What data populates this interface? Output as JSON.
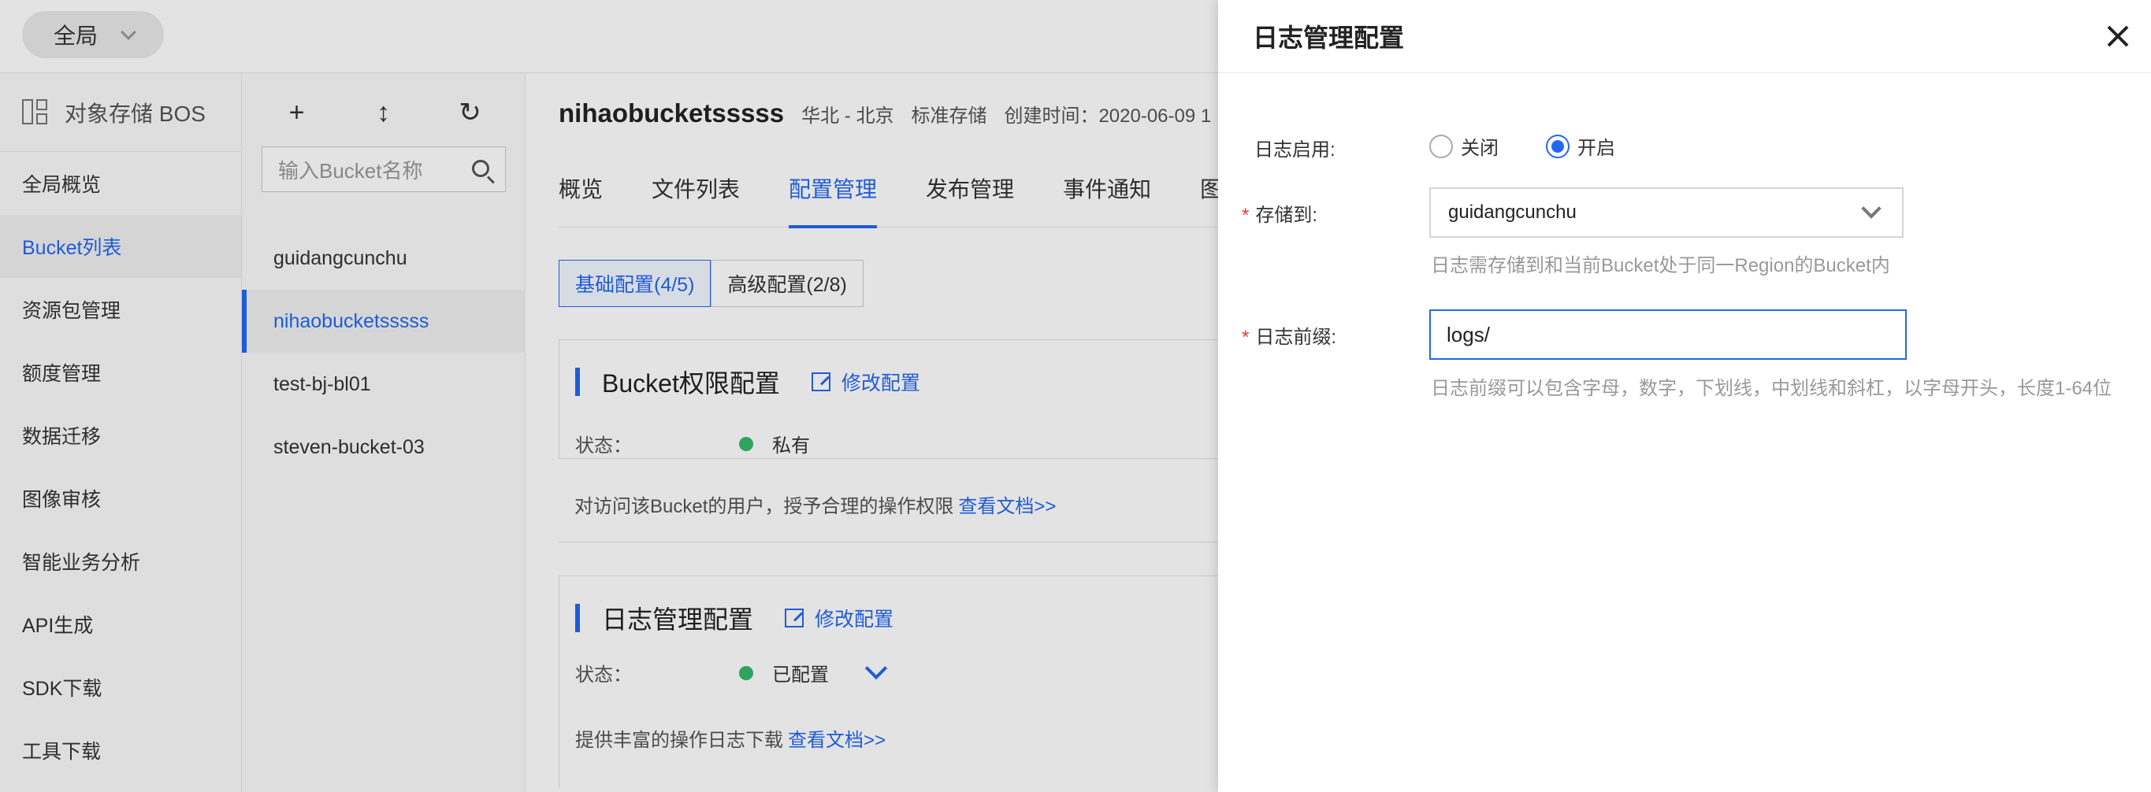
{
  "topbar": {
    "region": "全局"
  },
  "sidebar": {
    "title": "对象存储 BOS",
    "items": [
      {
        "label": "全局概览"
      },
      {
        "label": "Bucket列表"
      },
      {
        "label": "资源包管理"
      },
      {
        "label": "额度管理"
      },
      {
        "label": "数据迁移"
      },
      {
        "label": "图像审核"
      },
      {
        "label": "智能业务分析"
      },
      {
        "label": "API生成"
      },
      {
        "label": "SDK下载"
      },
      {
        "label": "工具下载"
      }
    ]
  },
  "bucket_panel": {
    "tool_add": "+",
    "tool_sort": "↕",
    "tool_refresh": "↻",
    "search_placeholder": "输入Bucket名称",
    "buckets": [
      {
        "name": "guidangcunchu"
      },
      {
        "name": "nihaobucketsssss"
      },
      {
        "name": "test-bj-bl01"
      },
      {
        "name": "steven-bucket-03"
      }
    ]
  },
  "main": {
    "bucket_name": "nihaobucketsssss",
    "region": "华北 - 北京",
    "storage_class": "标准存储",
    "created": "创建时间：2020-06-09 1",
    "tabs": [
      {
        "label": "概览"
      },
      {
        "label": "文件列表"
      },
      {
        "label": "配置管理"
      },
      {
        "label": "发布管理"
      },
      {
        "label": "事件通知"
      },
      {
        "label": "图片"
      }
    ],
    "subtabs": [
      {
        "label": "基础配置(4/5)"
      },
      {
        "label": "高级配置(2/8)"
      }
    ],
    "cards": [
      {
        "title": "Bucket权限配置",
        "edit": "修改配置",
        "status_label": "状态：",
        "status_value": "私有",
        "desc": "对访问该Bucket的用户，授予合理的操作权限",
        "doc_link": "查看文档>>"
      },
      {
        "title": "日志管理配置",
        "edit": "修改配置",
        "status_label": "状态：",
        "status_value": "已配置",
        "desc": "提供丰富的操作日志下载",
        "doc_link": "查看文档>>"
      }
    ]
  },
  "drawer": {
    "title": "日志管理配置",
    "enable_label": "日志启用:",
    "radio_off": "关闭",
    "radio_on": "开启",
    "required_mark": "*",
    "store_label": "存储到:",
    "store_value": "guidangcunchu",
    "store_hint": "日志需存储到和当前Bucket处于同一Region的Bucket内",
    "prefix_label": "日志前缀:",
    "prefix_value": "logs/",
    "prefix_hint": "日志前缀可以包含字母，数字，下划线，中划线和斜杠，以字母开头，长度1-64位"
  }
}
